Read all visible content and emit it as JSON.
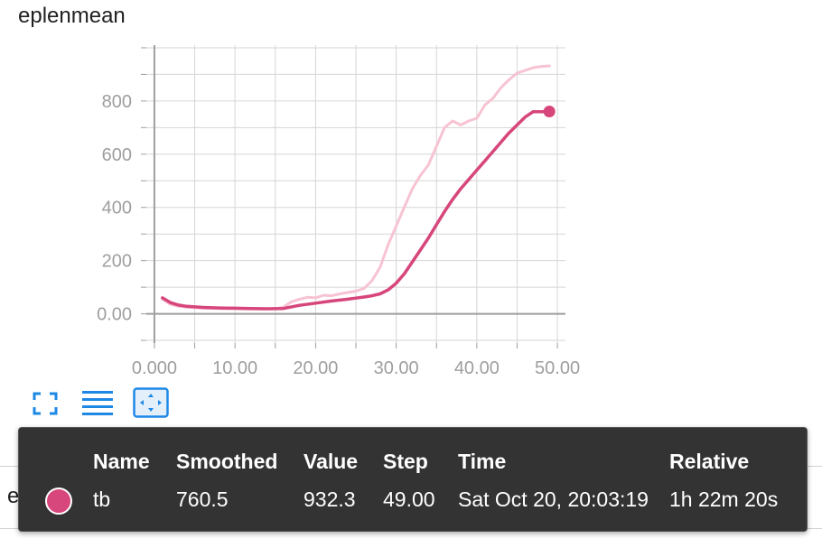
{
  "card": {
    "title": "eplenmean"
  },
  "run_row": {
    "label": "eplenmean"
  },
  "toolbar": {
    "buttons": [
      {
        "name": "fullscreen",
        "icon": "fullscreen-icon"
      },
      {
        "name": "toggle-y-log",
        "icon": "list-lines-icon"
      },
      {
        "name": "fit-domain",
        "icon": "fit-to-data-icon"
      }
    ]
  },
  "colors": {
    "accent": "#1e88e5",
    "smoothed_line": "#d7467b",
    "raw_line": "#f7c3d2",
    "tooltip_bg": "#333333"
  },
  "tooltip": {
    "headers": {
      "name": "Name",
      "smoothed": "Smoothed",
      "value": "Value",
      "step": "Step",
      "time": "Time",
      "relative": "Relative"
    },
    "row": {
      "name": "tb",
      "smoothed": "760.5",
      "value": "932.3",
      "step": "49.00",
      "time": "Sat Oct 20, 20:03:19",
      "relative": "1h 22m 20s"
    }
  },
  "chart_data": {
    "type": "line",
    "title": "",
    "xlabel": "",
    "ylabel": "",
    "xlim": [
      -1,
      51
    ],
    "ylim": [
      -110,
      1010
    ],
    "x_ticks": [
      0,
      10,
      20,
      30,
      40,
      50
    ],
    "x_tick_labels": [
      "0.000",
      "10.00",
      "20.00",
      "30.00",
      "40.00",
      "50.00"
    ],
    "y_ticks": [
      0,
      200,
      400,
      600,
      800
    ],
    "y_tick_labels": [
      "0.00",
      "200",
      "400",
      "600",
      "800"
    ],
    "grid": true,
    "series": [
      {
        "kind": "raw",
        "x": [
          1,
          2,
          3,
          4,
          5,
          6,
          8,
          10,
          12,
          14,
          15,
          16,
          17,
          18,
          19,
          20,
          21,
          22,
          23,
          24,
          25,
          26,
          27,
          28,
          29,
          30,
          31,
          32,
          33,
          34,
          35,
          36,
          37,
          38,
          39,
          40,
          41,
          42,
          43,
          44,
          45,
          46,
          47,
          48,
          49
        ],
        "y": [
          55,
          35,
          28,
          25,
          23,
          21,
          20,
          19,
          18,
          18,
          19,
          25,
          45,
          55,
          62,
          60,
          70,
          68,
          75,
          80,
          85,
          95,
          125,
          175,
          260,
          330,
          400,
          470,
          520,
          560,
          630,
          700,
          725,
          710,
          725,
          735,
          785,
          810,
          850,
          880,
          905,
          915,
          925,
          930,
          932
        ]
      },
      {
        "kind": "smoothed",
        "x": [
          1,
          2,
          3,
          4,
          5,
          6,
          8,
          10,
          12,
          14,
          16,
          18,
          20,
          22,
          24,
          25,
          26,
          27,
          28,
          29,
          30,
          31,
          32,
          33,
          34,
          35,
          36,
          37,
          38,
          39,
          40,
          41,
          42,
          43,
          44,
          45,
          46,
          47,
          48,
          49
        ],
        "y": [
          60,
          42,
          33,
          28,
          26,
          24,
          22,
          21,
          20,
          19,
          20,
          32,
          40,
          48,
          55,
          59,
          63,
          68,
          75,
          90,
          115,
          150,
          195,
          240,
          285,
          335,
          385,
          430,
          470,
          505,
          540,
          575,
          610,
          645,
          680,
          710,
          740,
          760,
          760,
          760.5
        ]
      }
    ]
  }
}
